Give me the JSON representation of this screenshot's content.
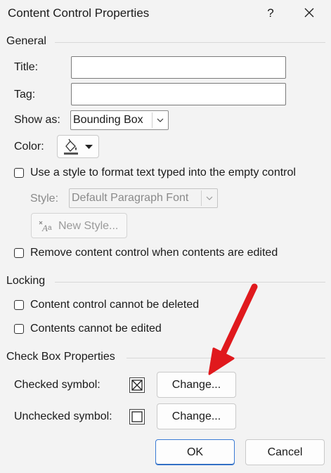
{
  "window": {
    "title": "Content Control Properties",
    "help": "?",
    "close_icon": "close-icon"
  },
  "general": {
    "heading": "General",
    "title_label": "Title:",
    "title_value": "",
    "tag_label": "Tag:",
    "tag_value": "",
    "showas_label": "Show as:",
    "showas_value": "Bounding Box",
    "color_label": "Color:",
    "use_style_label": "Use a style to format text typed into the empty control",
    "use_style_checked": false,
    "style_label": "Style:",
    "style_value": "Default Paragraph Font",
    "new_style_label": "New Style...",
    "remove_label": "Remove content control when contents are edited",
    "remove_checked": false
  },
  "locking": {
    "heading": "Locking",
    "cannot_delete_label": "Content control cannot be deleted",
    "cannot_edit_label": "Contents cannot be edited"
  },
  "checkbox_props": {
    "heading": "Check Box Properties",
    "checked_label": "Checked symbol:",
    "checked_symbol": "☒",
    "unchecked_label": "Unchecked symbol:",
    "unchecked_symbol": "☐",
    "change_label": "Change..."
  },
  "footer": {
    "ok": "OK",
    "cancel": "Cancel"
  },
  "colors": {
    "accent": "#3a7bd5",
    "annotation_arrow": "#e0191d"
  }
}
